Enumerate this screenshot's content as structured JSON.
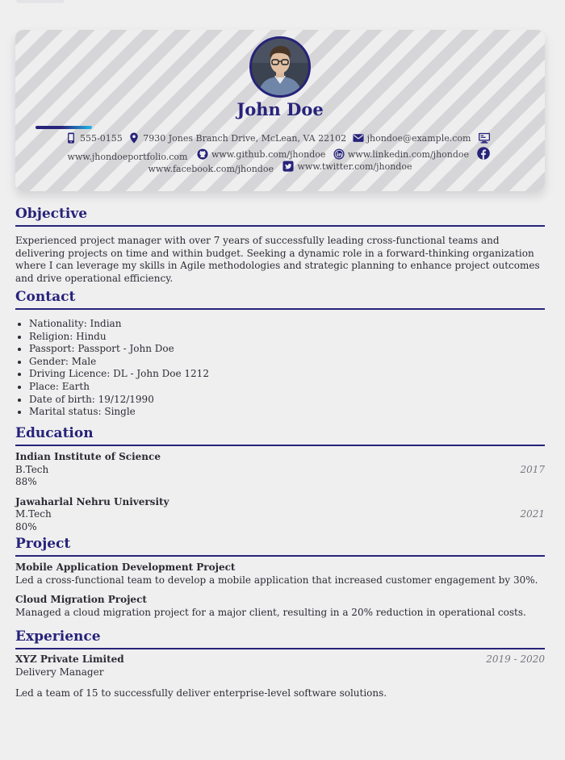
{
  "header": {
    "name": "John Doe",
    "phone": "555-0155",
    "address": "7930 Jones Branch Drive, McLean, VA 22102",
    "email": "jhondoe@example.com",
    "portfolio": "www.jhondoeportfolio.com",
    "github": "www.github.com/jhondoe",
    "linkedin": "www.linkedin.com/jhondoe",
    "facebook": "www.facebook.com/jhondoe",
    "twitter": "www.twitter.com/jhondoe"
  },
  "colors": {
    "accent": "#27237a",
    "accent_light": "#1fb6ea"
  },
  "objective": {
    "title": "Objective",
    "text": "Experienced project manager with over 7 years of successfully leading cross-functional teams and delivering projects on time and within budget. Seeking a dynamic role in a forward-thinking organization where I can leverage my skills in Agile methodologies and strategic planning to enhance project outcomes and drive operational efficiency."
  },
  "contact": {
    "title": "Contact",
    "items": [
      "Nationality: Indian",
      "Religion: Hindu",
      "Passport: Passport - John Doe",
      "Gender: Male",
      "Driving Licence: DL - John Doe 1212",
      "Place: Earth",
      "Date of birth: 19/12/1990",
      "Marital status: Single"
    ]
  },
  "education": {
    "title": "Education",
    "entries": [
      {
        "school": "Indian Institute of Science",
        "degree": "B.Tech",
        "year": "2017",
        "score": "88%"
      },
      {
        "school": "Jawaharlal Nehru University",
        "degree": "M.Tech",
        "year": "2021",
        "score": "80%"
      }
    ]
  },
  "project": {
    "title": "Project",
    "entries": [
      {
        "name": "Mobile Application Development Project",
        "desc": "Led a cross-functional team to develop a mobile application that increased customer engagement by 30%."
      },
      {
        "name": "Cloud Migration Project",
        "desc": "Managed a cloud migration project for a major client, resulting in a 20% reduction in operational costs."
      }
    ]
  },
  "experience": {
    "title": "Experience",
    "entries": [
      {
        "company": "XYZ Private Limited",
        "period": "2019 - 2020",
        "role": "Delivery Manager",
        "desc": "Led a team of 15 to successfully deliver enterprise-level software solutions."
      }
    ]
  }
}
